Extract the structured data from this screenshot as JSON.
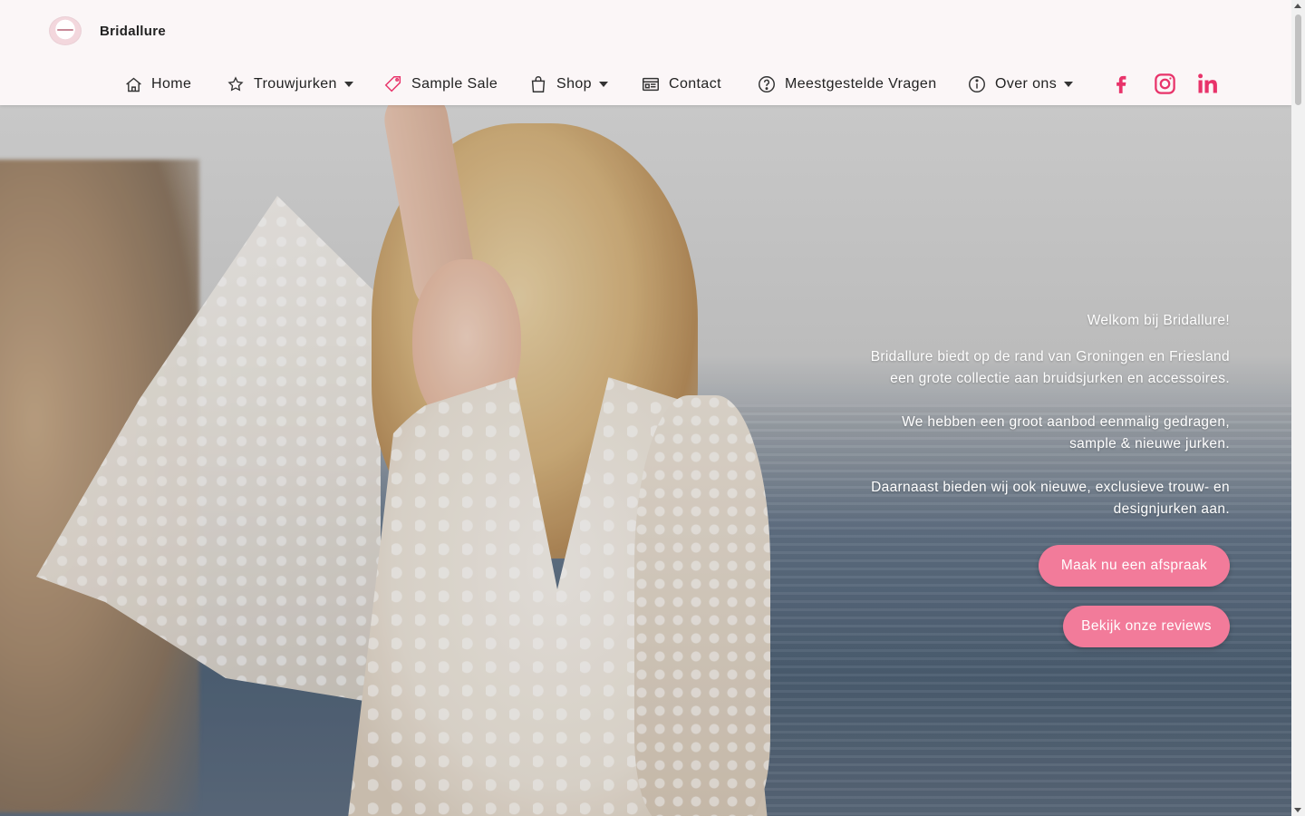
{
  "brand": {
    "name": "Bridallure",
    "logo_text": "Bridallure"
  },
  "nav": {
    "items": [
      {
        "label": "Home",
        "icon": "home-icon",
        "dropdown": false
      },
      {
        "label": "Trouwjurken",
        "icon": "star-icon",
        "dropdown": true
      },
      {
        "label": "Sample Sale",
        "icon": "tag-icon",
        "dropdown": false
      },
      {
        "label": "Shop",
        "icon": "shopping-bag-icon",
        "dropdown": true
      },
      {
        "label": "Contact",
        "icon": "contact-card-icon",
        "dropdown": false
      },
      {
        "label": "Meestgestelde Vragen",
        "icon": "question-icon",
        "dropdown": false
      },
      {
        "label": "Over ons",
        "icon": "info-icon",
        "dropdown": true
      }
    ]
  },
  "social": {
    "facebook": {
      "label": "Facebook",
      "icon": "facebook-icon"
    },
    "instagram": {
      "label": "Instagram",
      "icon": "instagram-icon"
    },
    "linkedin": {
      "label": "LinkedIn",
      "icon": "linkedin-icon"
    }
  },
  "hero": {
    "welcome": "Welkom bij Bridallure!",
    "p1_line1": "Bridallure biedt op de rand van Groningen en Friesland",
    "p1_line2": "een grote collectie aan bruidsjurken en accessoires.",
    "p2_line1": "We hebben een groot aanbod eenmalig gedragen,",
    "p2_line2": "sample & nieuwe jurken.",
    "p3_line1": "Daarnaast bieden wij ook nieuwe, exclusieve trouw- en",
    "p3_line2": "designjurken aan.",
    "cta_appointment": "Maak nu een afspraak",
    "cta_reviews": "Bekijk onze reviews"
  },
  "colors": {
    "accent": "#f27b9a",
    "social_pink": "#e8336a",
    "header_bg": "#fbf6f7",
    "text_dark": "#222222"
  }
}
